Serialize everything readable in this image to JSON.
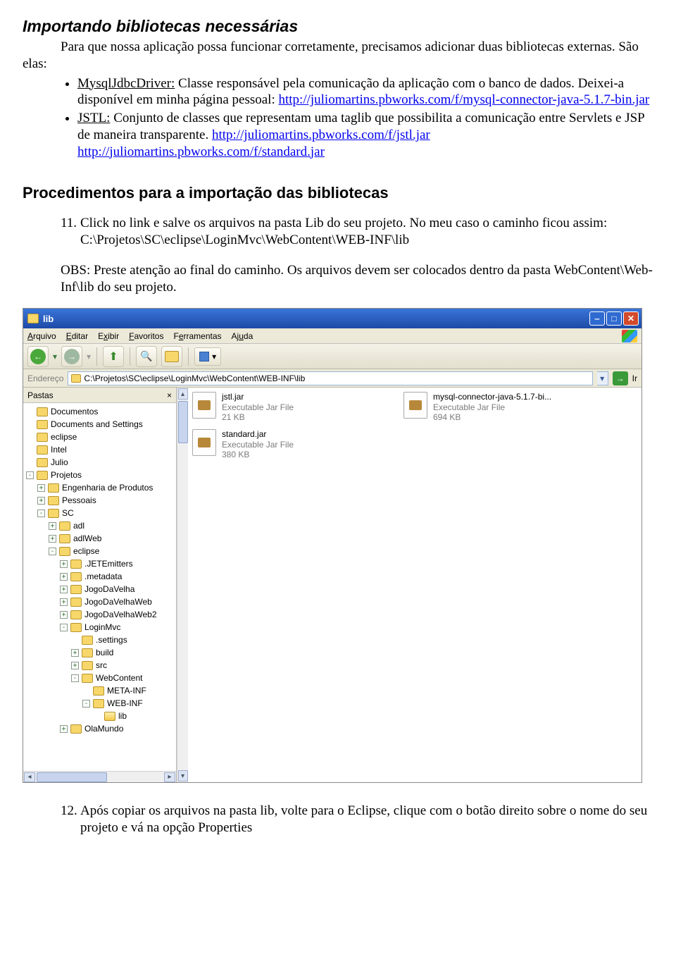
{
  "section1": {
    "title": "Importando bibliotecas necessárias",
    "intro": "Para que nossa aplicação possa funcionar corretamente, precisamos adicionar duas bibliotecas externas. São elas:",
    "bullets": [
      {
        "lead": "MysqlJdbcDriver:",
        "text1": " Classe responsável pela comunicação da aplicação com o banco de dados. Deixei-a disponível em minha página pessoal: ",
        "link": "http://juliomartins.pbworks.com/f/mysql-connector-java-5.1.7-bin.jar"
      },
      {
        "lead": "JSTL:",
        "text1": " Conjunto de classes que representam uma taglib que possibilita a comunicação entre Servlets e JSP de maneira transparente. ",
        "link1": "http://juliomartins.pbworks.com/f/jstl.jar",
        "link2": "http://juliomartins.pbworks.com/f/standard.jar"
      }
    ]
  },
  "section2": {
    "title": "Procedimentos para a importação das bibliotecas",
    "item11num": "11.",
    "item11": "Click no link e salve os arquivos na pasta Lib do seu projeto. No meu caso o caminho ficou assim: C:\\Projetos\\SC\\eclipse\\LoginMvc\\WebContent\\WEB-INF\\lib",
    "obs": "OBS: Preste atenção ao final do caminho. Os arquivos devem ser colocados dentro da pasta WebContent\\Web-Inf\\lib do seu projeto.",
    "item12num": "12.",
    "item12": "Após copiar os arquivos na pasta lib, volte para o Eclipse, clique com o botão direito sobre o nome do seu projeto e vá na opção Properties"
  },
  "explorer": {
    "title": "lib",
    "menu": {
      "arquivo": "Arquivo",
      "editar": "Editar",
      "exibir": "Exibir",
      "favoritos": "Favoritos",
      "ferramentas": "Ferramentas",
      "ajuda": "Ajuda"
    },
    "addr_label": "Endereço",
    "address": "C:\\Projetos\\SC\\eclipse\\LoginMvc\\WebContent\\WEB-INF\\lib",
    "go": "Ir",
    "pastas": "Pastas",
    "files": [
      {
        "name": "jstl.jar",
        "type": "Executable Jar File",
        "size": "21 KB"
      },
      {
        "name": "mysql-connector-java-5.1.7-bi...",
        "type": "Executable Jar File",
        "size": "694 KB"
      },
      {
        "name": "standard.jar",
        "type": "Executable Jar File",
        "size": "380 KB"
      }
    ],
    "tree": [
      {
        "lvl": 0,
        "exp": "",
        "label": "Documentos"
      },
      {
        "lvl": 0,
        "exp": "",
        "label": "Documents and Settings"
      },
      {
        "lvl": 0,
        "exp": "",
        "label": "eclipse"
      },
      {
        "lvl": 0,
        "exp": "",
        "label": "Intel"
      },
      {
        "lvl": 0,
        "exp": "",
        "label": "Julio"
      },
      {
        "lvl": 0,
        "exp": "-",
        "label": "Projetos"
      },
      {
        "lvl": 1,
        "exp": "+",
        "label": "Engenharia de Produtos"
      },
      {
        "lvl": 1,
        "exp": "+",
        "label": "Pessoais"
      },
      {
        "lvl": 1,
        "exp": "-",
        "label": "SC"
      },
      {
        "lvl": 2,
        "exp": "+",
        "label": "adl"
      },
      {
        "lvl": 2,
        "exp": "+",
        "label": "adlWeb"
      },
      {
        "lvl": 2,
        "exp": "-",
        "label": "eclipse"
      },
      {
        "lvl": 3,
        "exp": "+",
        "label": ".JETEmitters"
      },
      {
        "lvl": 3,
        "exp": "+",
        "label": ".metadata"
      },
      {
        "lvl": 3,
        "exp": "+",
        "label": "JogoDaVelha"
      },
      {
        "lvl": 3,
        "exp": "+",
        "label": "JogoDaVelhaWeb"
      },
      {
        "lvl": 3,
        "exp": "+",
        "label": "JogoDaVelhaWeb2"
      },
      {
        "lvl": 3,
        "exp": "-",
        "label": "LoginMvc"
      },
      {
        "lvl": 4,
        "exp": "",
        "label": ".settings"
      },
      {
        "lvl": 4,
        "exp": "+",
        "label": "build"
      },
      {
        "lvl": 4,
        "exp": "+",
        "label": "src"
      },
      {
        "lvl": 4,
        "exp": "-",
        "label": "WebContent"
      },
      {
        "lvl": 5,
        "exp": "",
        "label": "META-INF"
      },
      {
        "lvl": 5,
        "exp": "-",
        "label": "WEB-INF"
      },
      {
        "lvl": 6,
        "exp": "",
        "label": "lib",
        "open": true
      },
      {
        "lvl": 3,
        "exp": "+",
        "label": "OlaMundo"
      }
    ]
  }
}
